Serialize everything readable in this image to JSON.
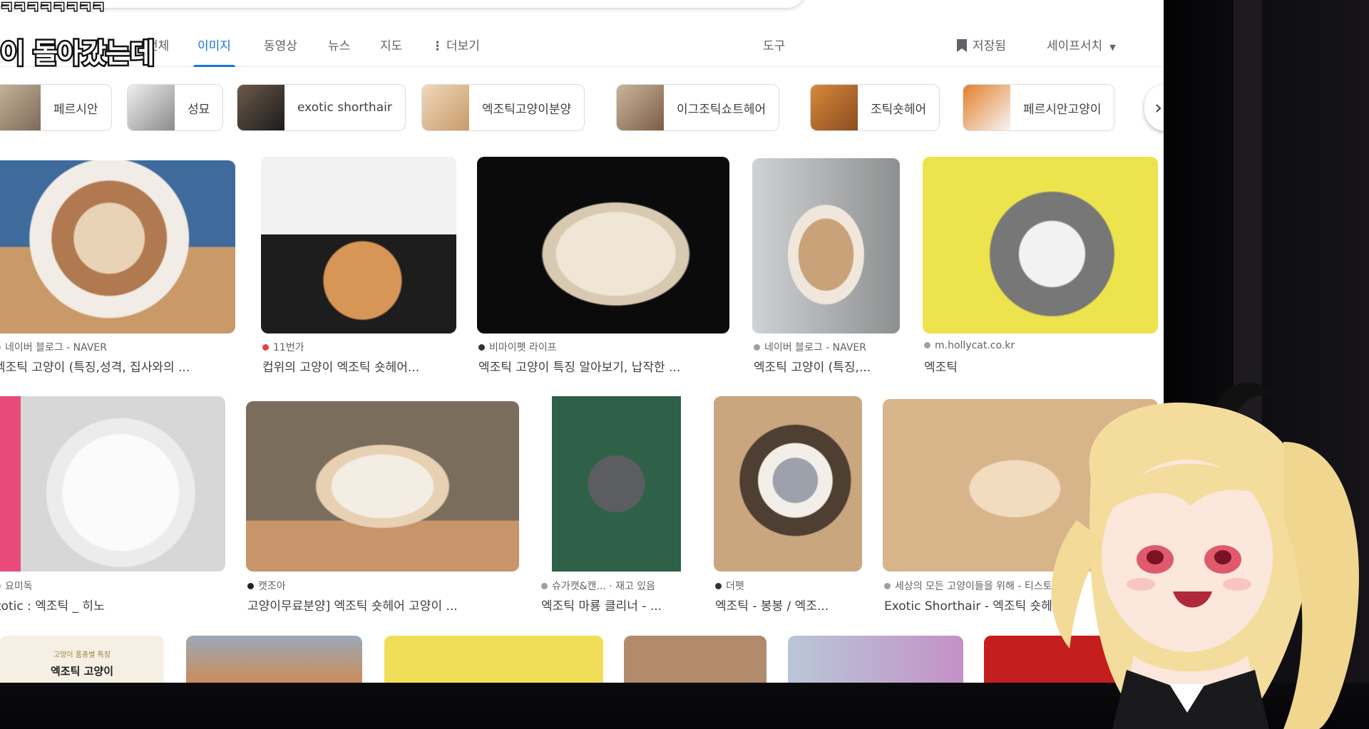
{
  "caption": {
    "top": "ㅋㅋㅋㅋㅋㅋㅋㅋ",
    "main": "이 돌아갔는데"
  },
  "tabs": {
    "all": "전체",
    "images": "이미지",
    "videos": "동영상",
    "news": "뉴스",
    "maps": "지도",
    "more": "더보기",
    "tools": "도구",
    "saved": "저장됨",
    "safesearch": "세이프서치"
  },
  "chips": [
    {
      "label": "페르시안",
      "thumb": "persian-cat"
    },
    {
      "label": "성묘",
      "thumb": "adult-cat"
    },
    {
      "label": "exotic shorthair",
      "thumb": "exotic-cat"
    },
    {
      "label": "엑조틱고양이분양",
      "thumb": "kitten"
    },
    {
      "label": "이그조틱쇼트헤어",
      "thumb": "cats"
    },
    {
      "label": "조틱숏헤어",
      "thumb": "orange-cat"
    },
    {
      "label": "페르시안고양이",
      "thumb": "calico-cat"
    }
  ],
  "results_row1": [
    {
      "source": "네이버 블로그 - NAVER",
      "title": "엑조틱 고양이 (특징,성격, 집사와의 ..."
    },
    {
      "source": "11번가",
      "title": "컵위의 고양이 엑조틱 숏헤어..."
    },
    {
      "source": "비마이펫 라이프",
      "title": "엑조틱 고양이 특징 알아보기, 납작한 ..."
    },
    {
      "source": "네이버 블로그 - NAVER",
      "title": "엑조틱 고양이 (특징,..."
    },
    {
      "source": "m.hollycat.co.kr",
      "title": "엑조틱"
    }
  ],
  "results_row2": [
    {
      "source": "요미독",
      "title": "xotic : 엑조틱 _ 히노"
    },
    {
      "source": "캣조아",
      "title": "고양이무료분양] 엑조틱 숏헤어 고양이 ..."
    },
    {
      "source": "슈가캣&캔...",
      "stock": "재고 있음",
      "title": "엑조틱 마룡 클리너 - ..."
    },
    {
      "source": "더펫",
      "title": "엑조틱 - 봉봉 / 엑조..."
    },
    {
      "source": "세상의 모든 고양이들을 위해 - 티스토리",
      "title": "Exotic Shorthair - 엑조틱 숏헤어"
    }
  ],
  "row3_card": {
    "sub": "고양이 품종별 특징",
    "main": "엑조틱 고양이"
  },
  "colors": {
    "accent": "#1a73e8",
    "text": "#3c4043",
    "muted": "#5f6368"
  }
}
